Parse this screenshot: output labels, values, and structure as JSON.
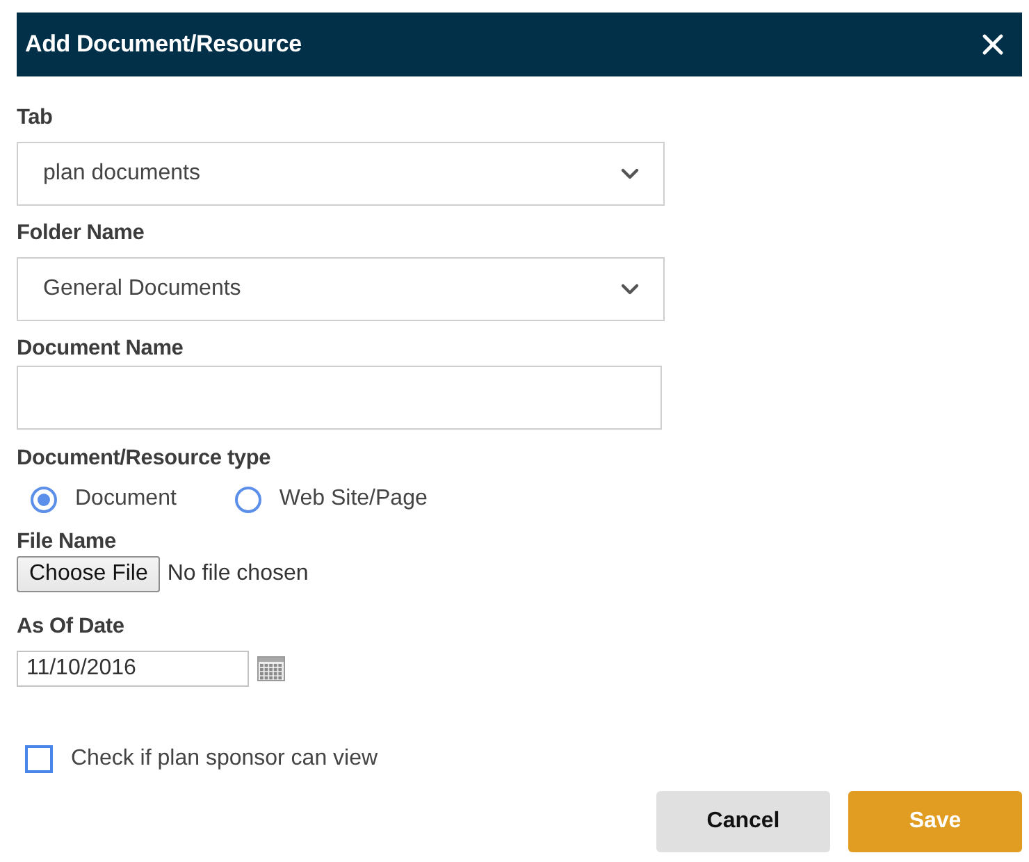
{
  "dialog": {
    "title": "Add Document/Resource"
  },
  "fields": [
    {
      "kind": "select",
      "label": "Tab",
      "value": "plan documents"
    },
    {
      "kind": "select",
      "label": "Folder Name",
      "value": "General Documents"
    },
    {
      "kind": "text",
      "label": "Document Name"
    }
  ],
  "resource_type": {
    "label": "Document/Resource type",
    "options": [
      {
        "label": "Document",
        "selected": true
      },
      {
        "label": "Web Site/Page",
        "selected": false
      }
    ]
  },
  "file": {
    "label": "File Name",
    "button": "Choose File",
    "status": "No file chosen"
  },
  "as_of_date": {
    "label": "As Of Date",
    "value": "11/10/2016"
  },
  "sponsor_view": {
    "label": "Check if plan sponsor can view",
    "checked": false
  },
  "buttons": [
    {
      "kind": "secondary",
      "label": "Cancel"
    },
    {
      "kind": "primary",
      "label": "Save"
    }
  ]
}
